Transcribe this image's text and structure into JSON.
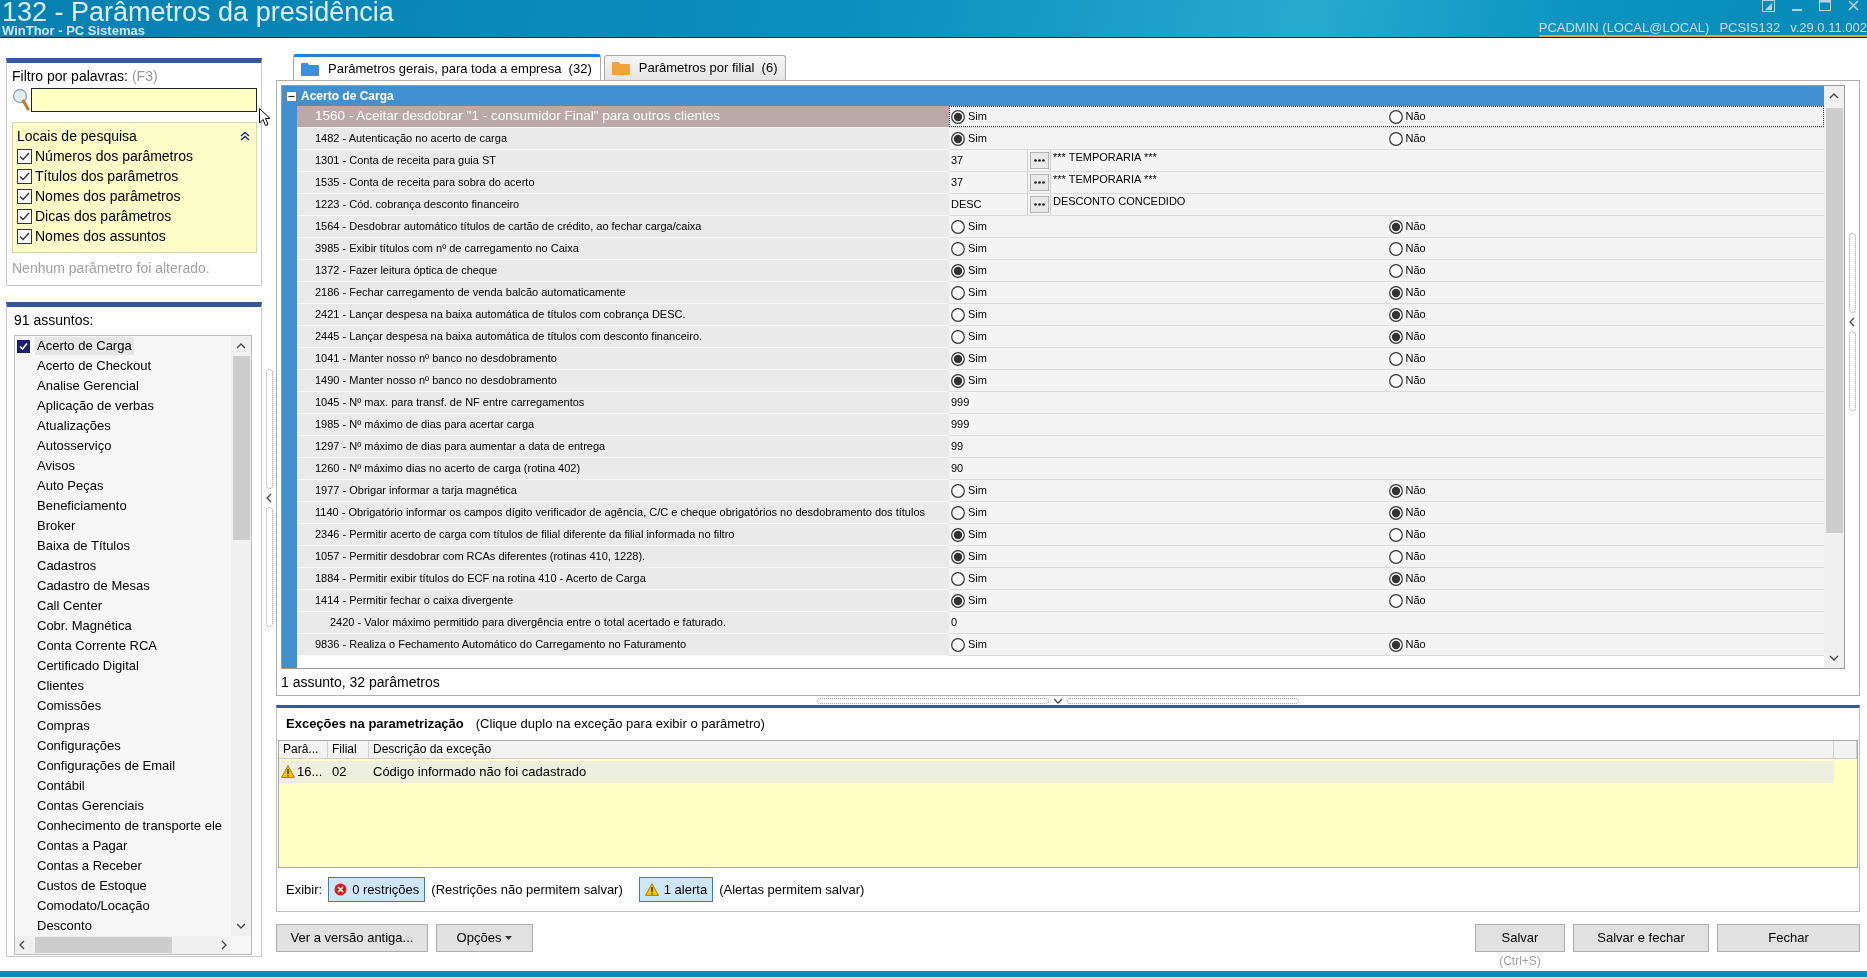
{
  "window": {
    "title": "132 - Parâmetros da presidência",
    "subtitle": "WinThor - PC Sistemas",
    "session": [
      "PCADMIN (LOCAL@LOCAL)",
      "PCSIS132",
      "v.29.0.11.002"
    ]
  },
  "filter": {
    "label": "Filtro por palavras:",
    "shortcut": "(F3)",
    "search_locations": {
      "title": "Locais de pesquisa",
      "expanded": true,
      "options": [
        {
          "label": "Números dos parâmetros",
          "checked": true
        },
        {
          "label": "Títulos dos parâmetros",
          "checked": true
        },
        {
          "label": "Nomes dos parâmetros",
          "checked": true
        },
        {
          "label": "Dicas dos parâmetros",
          "checked": true
        },
        {
          "label": "Nomes dos assuntos",
          "checked": true
        }
      ]
    },
    "status": "Nenhum parâmetro foi alterado."
  },
  "subjects": {
    "count_label": "91 assuntos:",
    "items": [
      {
        "label": "Acerto de Carga",
        "checked": true,
        "selected": true
      },
      {
        "label": "Acerto de Checkout",
        "checked": false,
        "selected": false
      },
      {
        "label": "Analise Gerencial",
        "checked": false,
        "selected": false
      },
      {
        "label": "Aplicação de verbas",
        "checked": false,
        "selected": false
      },
      {
        "label": "Atualizações",
        "checked": false,
        "selected": false
      },
      {
        "label": "Autosserviço",
        "checked": false,
        "selected": false
      },
      {
        "label": "Avisos",
        "checked": false,
        "selected": false
      },
      {
        "label": "Auto Peças",
        "checked": false,
        "selected": false
      },
      {
        "label": "Beneficiamento",
        "checked": false,
        "selected": false
      },
      {
        "label": "Broker",
        "checked": false,
        "selected": false
      },
      {
        "label": "Baixa de Títulos",
        "checked": false,
        "selected": false
      },
      {
        "label": "Cadastros",
        "checked": false,
        "selected": false
      },
      {
        "label": "Cadastro de Mesas",
        "checked": false,
        "selected": false
      },
      {
        "label": "Call Center",
        "checked": false,
        "selected": false
      },
      {
        "label": "Cobr. Magnética",
        "checked": false,
        "selected": false
      },
      {
        "label": "Conta Corrente RCA",
        "checked": false,
        "selected": false
      },
      {
        "label": "Certificado Digital",
        "checked": false,
        "selected": false
      },
      {
        "label": "Clientes",
        "checked": false,
        "selected": false
      },
      {
        "label": "Comissões",
        "checked": false,
        "selected": false
      },
      {
        "label": "Compras",
        "checked": false,
        "selected": false
      },
      {
        "label": "Configurações",
        "checked": false,
        "selected": false
      },
      {
        "label": "Configurações de Email",
        "checked": false,
        "selected": false
      },
      {
        "label": "Contábil",
        "checked": false,
        "selected": false
      },
      {
        "label": "Contas Gerenciais",
        "checked": false,
        "selected": false
      },
      {
        "label": "Conhecimento de transporte ele",
        "checked": false,
        "selected": false
      },
      {
        "label": "Contas a Pagar",
        "checked": false,
        "selected": false
      },
      {
        "label": "Contas a Receber",
        "checked": false,
        "selected": false
      },
      {
        "label": "Custos de Estoque",
        "checked": false,
        "selected": false
      },
      {
        "label": "Comodato/Locação",
        "checked": false,
        "selected": false
      },
      {
        "label": "Desconto",
        "checked": false,
        "selected": false
      }
    ]
  },
  "tabs": [
    {
      "label": "Parâmetros gerais, para toda a empresa  (32)",
      "selected": true,
      "color": "#3b8fe0"
    },
    {
      "label": "Parâmetros por filial  (6)",
      "selected": false,
      "color": "#f2a33a"
    }
  ],
  "grid": {
    "group": {
      "title": "Acerto de Carga",
      "expanded": true
    },
    "rows": [
      {
        "kind": "boolean",
        "label": "1560 - Aceitar desdobrar \"1 - consumidor Final\" para outros clientes",
        "selected": true,
        "options": [
          {
            "label": "Sim",
            "selected": true
          },
          {
            "label": "Não",
            "selected": false
          }
        ]
      },
      {
        "kind": "boolean",
        "label": "1482 - Autenticação no acerto de carga",
        "selected": false,
        "options": [
          {
            "label": "Sim",
            "selected": true
          },
          {
            "label": "Não",
            "selected": false
          }
        ]
      },
      {
        "kind": "lookup",
        "label": "1301 - Conta de receita para guia ST",
        "selected": false,
        "value": "37",
        "description": "*** TEMPORARIA ***"
      },
      {
        "kind": "lookup",
        "label": "1535 - Conta de receita para sobra do acerto",
        "selected": false,
        "value": "37",
        "description": "*** TEMPORARIA ***"
      },
      {
        "kind": "lookup",
        "label": "1223 - Cód. cobrança desconto financeiro",
        "selected": false,
        "value": "DESC",
        "description": "DESCONTO CONCEDIDO"
      },
      {
        "kind": "boolean",
        "label": "1564 - Desdobrar automático títulos de cartão de crédito, ao fechar carga/caixa",
        "selected": false,
        "options": [
          {
            "label": "Sim",
            "selected": false
          },
          {
            "label": "Não",
            "selected": true
          }
        ]
      },
      {
        "kind": "boolean",
        "label": "3985 - Exibir títulos com nº de carregamento no Caixa",
        "selected": false,
        "options": [
          {
            "label": "Sim",
            "selected": false
          },
          {
            "label": "Não",
            "selected": false
          }
        ]
      },
      {
        "kind": "boolean",
        "label": "1372 - Fazer leitura óptica de cheque",
        "selected": false,
        "options": [
          {
            "label": "Sim",
            "selected": true
          },
          {
            "label": "Não",
            "selected": false
          }
        ]
      },
      {
        "kind": "boolean",
        "label": "2186 - Fechar carregamento de venda balcão automaticamente",
        "selected": false,
        "options": [
          {
            "label": "Sim",
            "selected": false
          },
          {
            "label": "Não",
            "selected": true
          }
        ]
      },
      {
        "kind": "boolean",
        "label": "2421 - Lançar despesa na baixa automática de títulos com cobrança DESC.",
        "selected": false,
        "options": [
          {
            "label": "Sim",
            "selected": false
          },
          {
            "label": "Não",
            "selected": true
          }
        ]
      },
      {
        "kind": "boolean",
        "label": "2445 - Lançar despesa na baixa automática de títulos com desconto financeiro.",
        "selected": false,
        "options": [
          {
            "label": "Sim",
            "selected": false
          },
          {
            "label": "Não",
            "selected": true
          }
        ]
      },
      {
        "kind": "boolean",
        "label": "1041 - Manter nosso nº banco no desdobramento",
        "selected": false,
        "options": [
          {
            "label": "Sim",
            "selected": true
          },
          {
            "label": "Não",
            "selected": false
          }
        ]
      },
      {
        "kind": "boolean",
        "label": "1490 - Manter nosso nº banco no desdobramento",
        "selected": false,
        "options": [
          {
            "label": "Sim",
            "selected": true
          },
          {
            "label": "Não",
            "selected": false
          }
        ]
      },
      {
        "kind": "number",
        "label": "1045 - Nº max. para transf. de NF entre carregamentos",
        "selected": false,
        "value": "999"
      },
      {
        "kind": "number",
        "label": "1985 - Nº máximo de dias para acertar carga",
        "selected": false,
        "value": "999"
      },
      {
        "kind": "number",
        "label": "1297 - Nº máximo de dias para aumentar a data de entrega",
        "selected": false,
        "value": "99"
      },
      {
        "kind": "number",
        "label": "1260 - Nº máximo dias no acerto de carga (rotina 402)",
        "selected": false,
        "value": "90"
      },
      {
        "kind": "boolean",
        "label": "1977 - Obrigar informar a tarja magnética",
        "selected": false,
        "options": [
          {
            "label": "Sim",
            "selected": false
          },
          {
            "label": "Não",
            "selected": true
          }
        ]
      },
      {
        "kind": "boolean",
        "label": "1140 - Obrigatório informar os campos dígito verificador de agência, C/C e cheque obrigatórios no desdobramento dos títulos",
        "selected": false,
        "options": [
          {
            "label": "Sim",
            "selected": false
          },
          {
            "label": "Não",
            "selected": true
          }
        ]
      },
      {
        "kind": "boolean",
        "label": "2346 - Permitir acerto de carga com títulos de filial diferente da filial informada no filtro",
        "selected": false,
        "options": [
          {
            "label": "Sim",
            "selected": true
          },
          {
            "label": "Não",
            "selected": false
          }
        ]
      },
      {
        "kind": "boolean",
        "label": "1057 - Permitir desdobrar com RCAs diferentes (rotinas 410, 1228).",
        "selected": false,
        "options": [
          {
            "label": "Sim",
            "selected": true
          },
          {
            "label": "Não",
            "selected": false
          }
        ]
      },
      {
        "kind": "boolean",
        "label": "1884 - Permitir exibir títulos do ECF na rotina 410 - Acerto de Carga",
        "selected": false,
        "options": [
          {
            "label": "Sim",
            "selected": false
          },
          {
            "label": "Não",
            "selected": true
          }
        ]
      },
      {
        "kind": "boolean",
        "label": "1414 - Permitir fechar o caixa divergente",
        "selected": false,
        "options": [
          {
            "label": "Sim",
            "selected": true
          },
          {
            "label": "Não",
            "selected": false
          }
        ],
        "children": [
          {
            "kind": "number",
            "label": "2420 - Valor máximo permitido para divergência entre o total acertado e faturado.",
            "selected": false,
            "value": "0"
          }
        ]
      },
      {
        "kind": "boolean",
        "label": "9836 - Realiza o Fechamento Automático do Carregamento no Faturamento",
        "selected": false,
        "options": [
          {
            "label": "Sim",
            "selected": false
          },
          {
            "label": "Não",
            "selected": true
          }
        ]
      }
    ]
  },
  "status": "1 assunto, 32 parâmetros",
  "exceptions": {
    "title": "Exceções na parametrização",
    "hint": "(Clique duplo na exceção para exibir o parâmetro)",
    "columns": [
      "Parâ...",
      "Filial",
      "Descrição da exceção"
    ],
    "rows": [
      {
        "kind": "alert",
        "cells": [
          "16...",
          "02",
          "Código informado não foi cadastrado"
        ]
      }
    ],
    "show_label": "Exibir:",
    "toggles": [
      {
        "kind": "restriction",
        "label": "0 restrições",
        "note": "(Restrições não permitem salvar)",
        "selected": true
      },
      {
        "kind": "alert",
        "label": "1 alerta",
        "note": "(Alertas permitem salvar)",
        "selected": true
      }
    ]
  },
  "footer": {
    "left_buttons": [
      {
        "kind": "plain",
        "label": "Ver a versão antiga..."
      },
      {
        "kind": "dropdown",
        "label": "Opções"
      }
    ],
    "right_buttons": [
      {
        "label": "Salvar",
        "hint": "(Ctrl+S)"
      },
      {
        "label": "Salvar e fechar"
      },
      {
        "label": "Fechar"
      }
    ]
  }
}
